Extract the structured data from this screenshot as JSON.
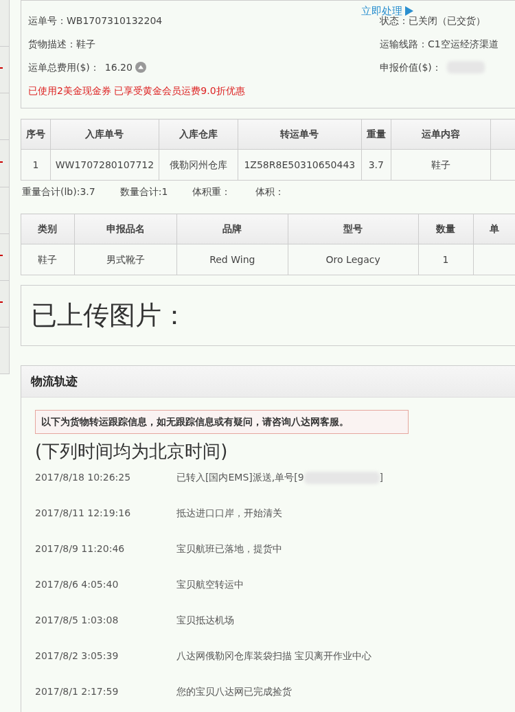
{
  "order_info": {
    "left": [
      {
        "label": "运单号：",
        "value": "WB1707310132204"
      },
      {
        "label": "货物描述：",
        "value": "鞋子"
      },
      {
        "label": "运单总费用($)：",
        "value": "16.20",
        "kind": "fee"
      }
    ],
    "right": [
      {
        "label": "状态：",
        "value": "已关闭（已交货）"
      },
      {
        "label": "运输线路：",
        "value": "C1空运经济渠道"
      },
      {
        "label": "申报价值($)：",
        "kind": "redacted"
      }
    ],
    "action_link": "立即处理",
    "notice": "已使用2美金现金券 已享受黄金会员运费9.0折优惠"
  },
  "parcels_table": {
    "columns": [
      "序号",
      "入库单号",
      "入库仓库",
      "转运单号",
      "重量",
      "运单内容",
      null
    ],
    "rows": [
      [
        "1",
        "WW1707280107712",
        "俄勒冈州仓库",
        "1Z58R8E50310650443",
        "3.7",
        "鞋子",
        null
      ]
    ]
  },
  "totals": [
    "重量合计(lb):3.7",
    "数量合计:1",
    "体积重：",
    "体积："
  ],
  "declaration_table": {
    "columns": [
      "类别",
      "申报品名",
      "品牌",
      "型号",
      "数量",
      "单"
    ],
    "rows": [
      [
        "鞋子",
        "男式靴子",
        "Red Wing",
        "Oro Legacy",
        "1",
        null
      ]
    ]
  },
  "uploaded_images": {
    "title": "已上传图片："
  },
  "tracking": {
    "title": "物流轨迹",
    "notice": "以下为货物转运跟踪信息，如无跟踪信息或有疑问，请咨询八达网客服。",
    "subtitle": "(下列时间均为北京时间)",
    "events": [
      {
        "time": "2017/8/18 10:26:25",
        "text": "已转入[国内EMS]派送,单号[9",
        "suffix": "]"
      },
      {
        "time": "2017/8/11 12:19:16",
        "text": "抵达进口口岸，开始清关"
      },
      {
        "time": "2017/8/9 11:20:46",
        "text": "宝贝航班已落地，提货中"
      },
      {
        "time": "2017/8/6 4:05:40",
        "text": "宝贝航空转运中"
      },
      {
        "time": "2017/8/5 1:03:08",
        "text": "宝贝抵达机场"
      },
      {
        "time": "2017/8/2 3:05:39",
        "text": "八达网俄勒冈仓库装袋扫描 宝贝离开作业中心"
      },
      {
        "time": "2017/8/1 2:17:59",
        "text": "您的宝贝八达网已完成捡货"
      }
    ]
  }
}
